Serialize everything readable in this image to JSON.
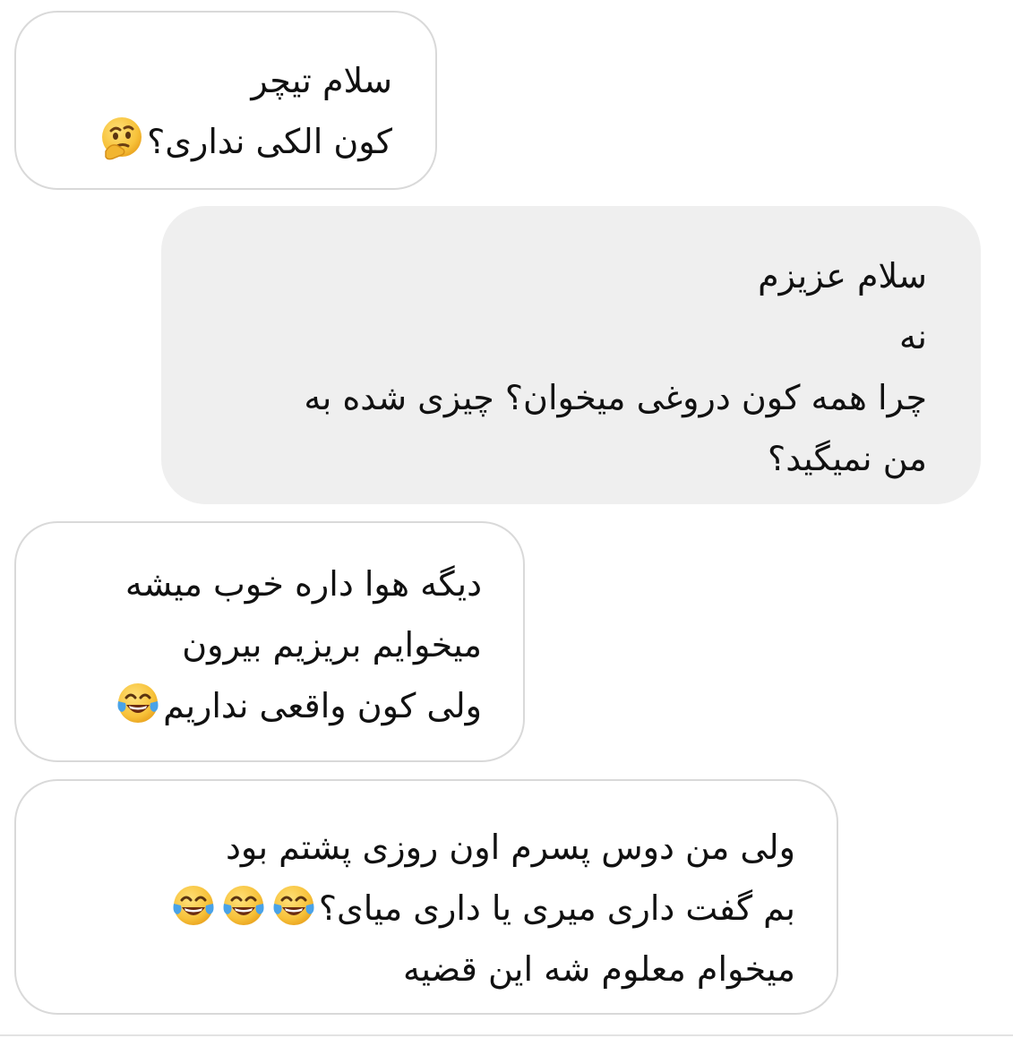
{
  "messages": [
    {
      "direction": "incoming",
      "lines": [
        {
          "text": "سلام تیچر",
          "emoji": ""
        },
        {
          "text": "کون الکی نداری؟",
          "emoji": "thinking-face-icon"
        }
      ]
    },
    {
      "direction": "outgoing",
      "lines": [
        {
          "text": "سلام عزیزم",
          "emoji": ""
        },
        {
          "text": "نه",
          "emoji": ""
        },
        {
          "text": "چرا همه کون دروغی میخوان؟ چیزی شده به",
          "emoji": ""
        },
        {
          "text": "من نمیگید؟",
          "emoji": ""
        }
      ]
    },
    {
      "direction": "incoming",
      "lines": [
        {
          "text": "دیگه هوا داره خوب میشه",
          "emoji": ""
        },
        {
          "text": "میخوایم بریزیم بیرون",
          "emoji": ""
        },
        {
          "text": "ولی کون واقعی نداریم",
          "emoji": "tears-of-joy-icon"
        }
      ]
    },
    {
      "direction": "incoming",
      "lines": [
        {
          "text": "ولی من دوس پسرم اون روزی پشتم بود",
          "emoji": ""
        },
        {
          "text": "بم گفت داری میری یا داری میای؟",
          "emoji": "tears-of-joy-icon x3"
        },
        {
          "text": "میخوام معلوم شه این قضیه",
          "emoji": ""
        }
      ]
    }
  ],
  "colors": {
    "incoming_bg": "#ffffff",
    "incoming_border": "#d9d9d9",
    "outgoing_bg": "#efefef",
    "text": "#111111",
    "emoji_face": "#f7c23a",
    "emoji_tear": "#4aa3e8"
  }
}
